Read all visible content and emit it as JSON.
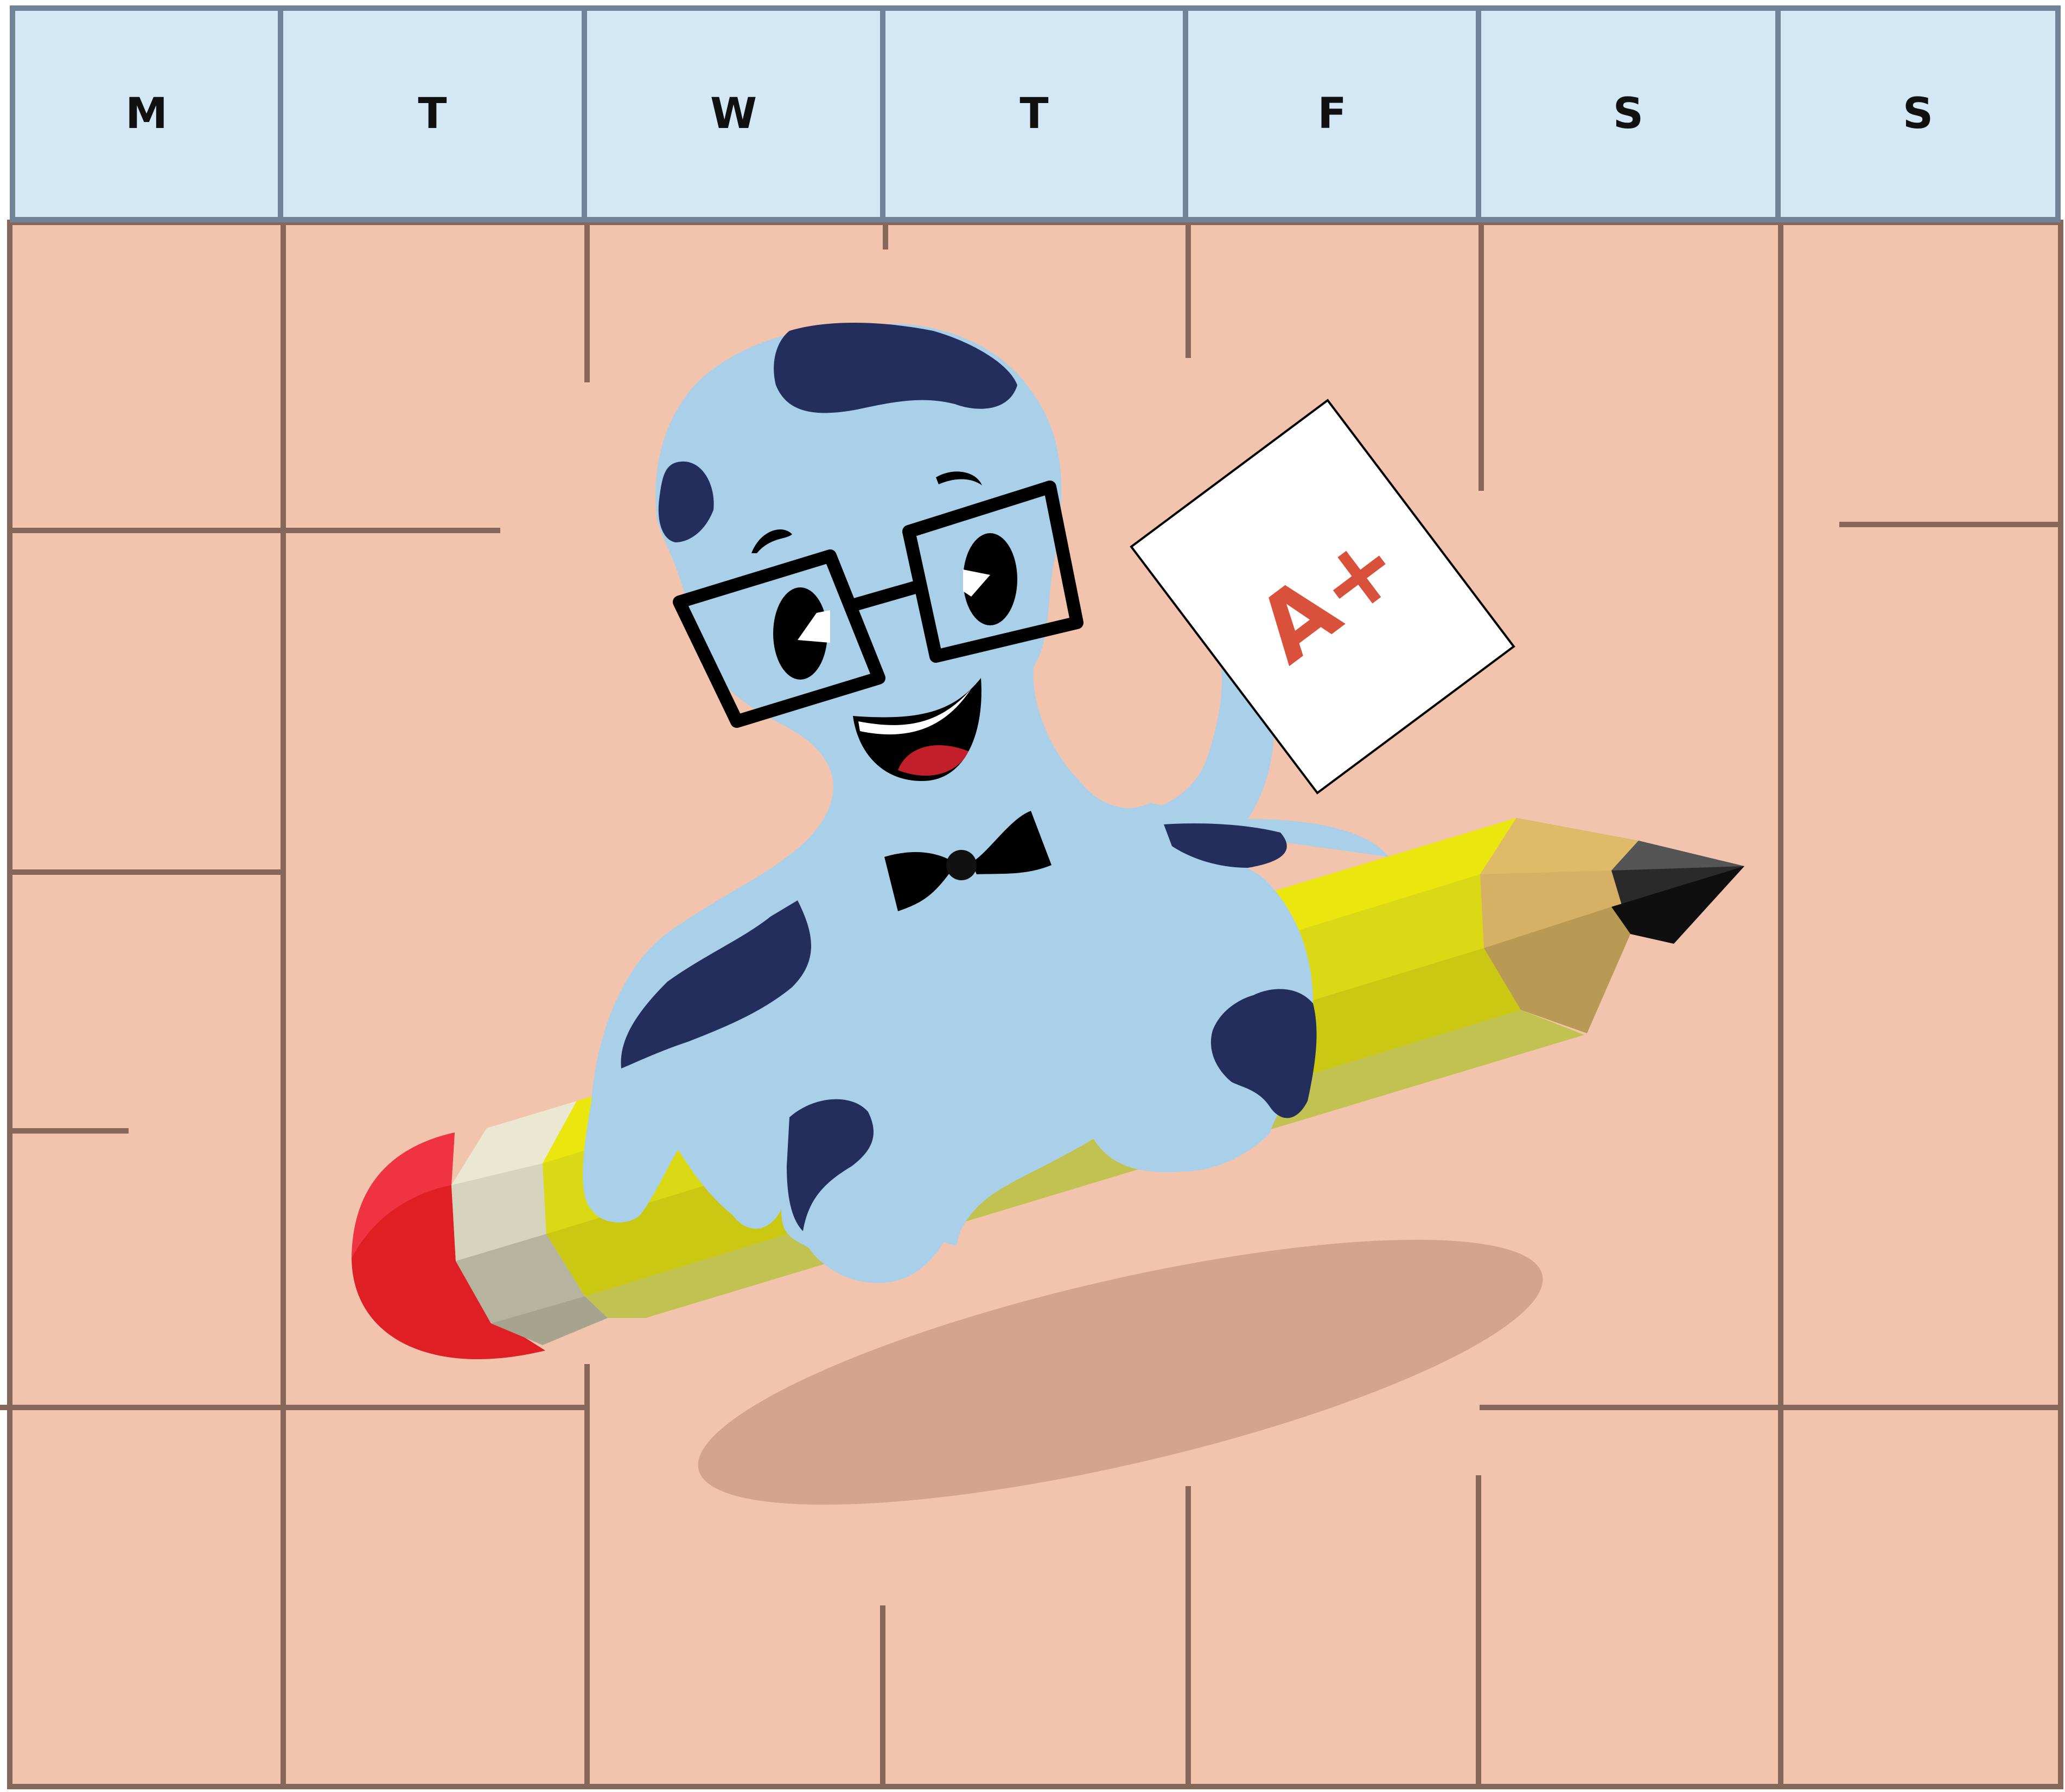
{
  "calendar": {
    "days": [
      "M",
      "T",
      "W",
      "T",
      "F",
      "S",
      "S"
    ]
  },
  "illustration": {
    "character": "blue spotted octopus with glasses and bow tie riding a pencil",
    "grade_paper_text": "A+"
  },
  "colors": {
    "header_fill": "#d4e7f5",
    "header_border": "#6f8496",
    "body_fill": "#f2c4ae",
    "grid_line": "#86675a",
    "octopus_body": "#a9d0e8",
    "octopus_spots": "#232e5c",
    "pencil_yellow": "#e2e014",
    "eraser_red": "#e01f25",
    "grade_red": "#d9513a",
    "shadow": "#d5a48e"
  }
}
